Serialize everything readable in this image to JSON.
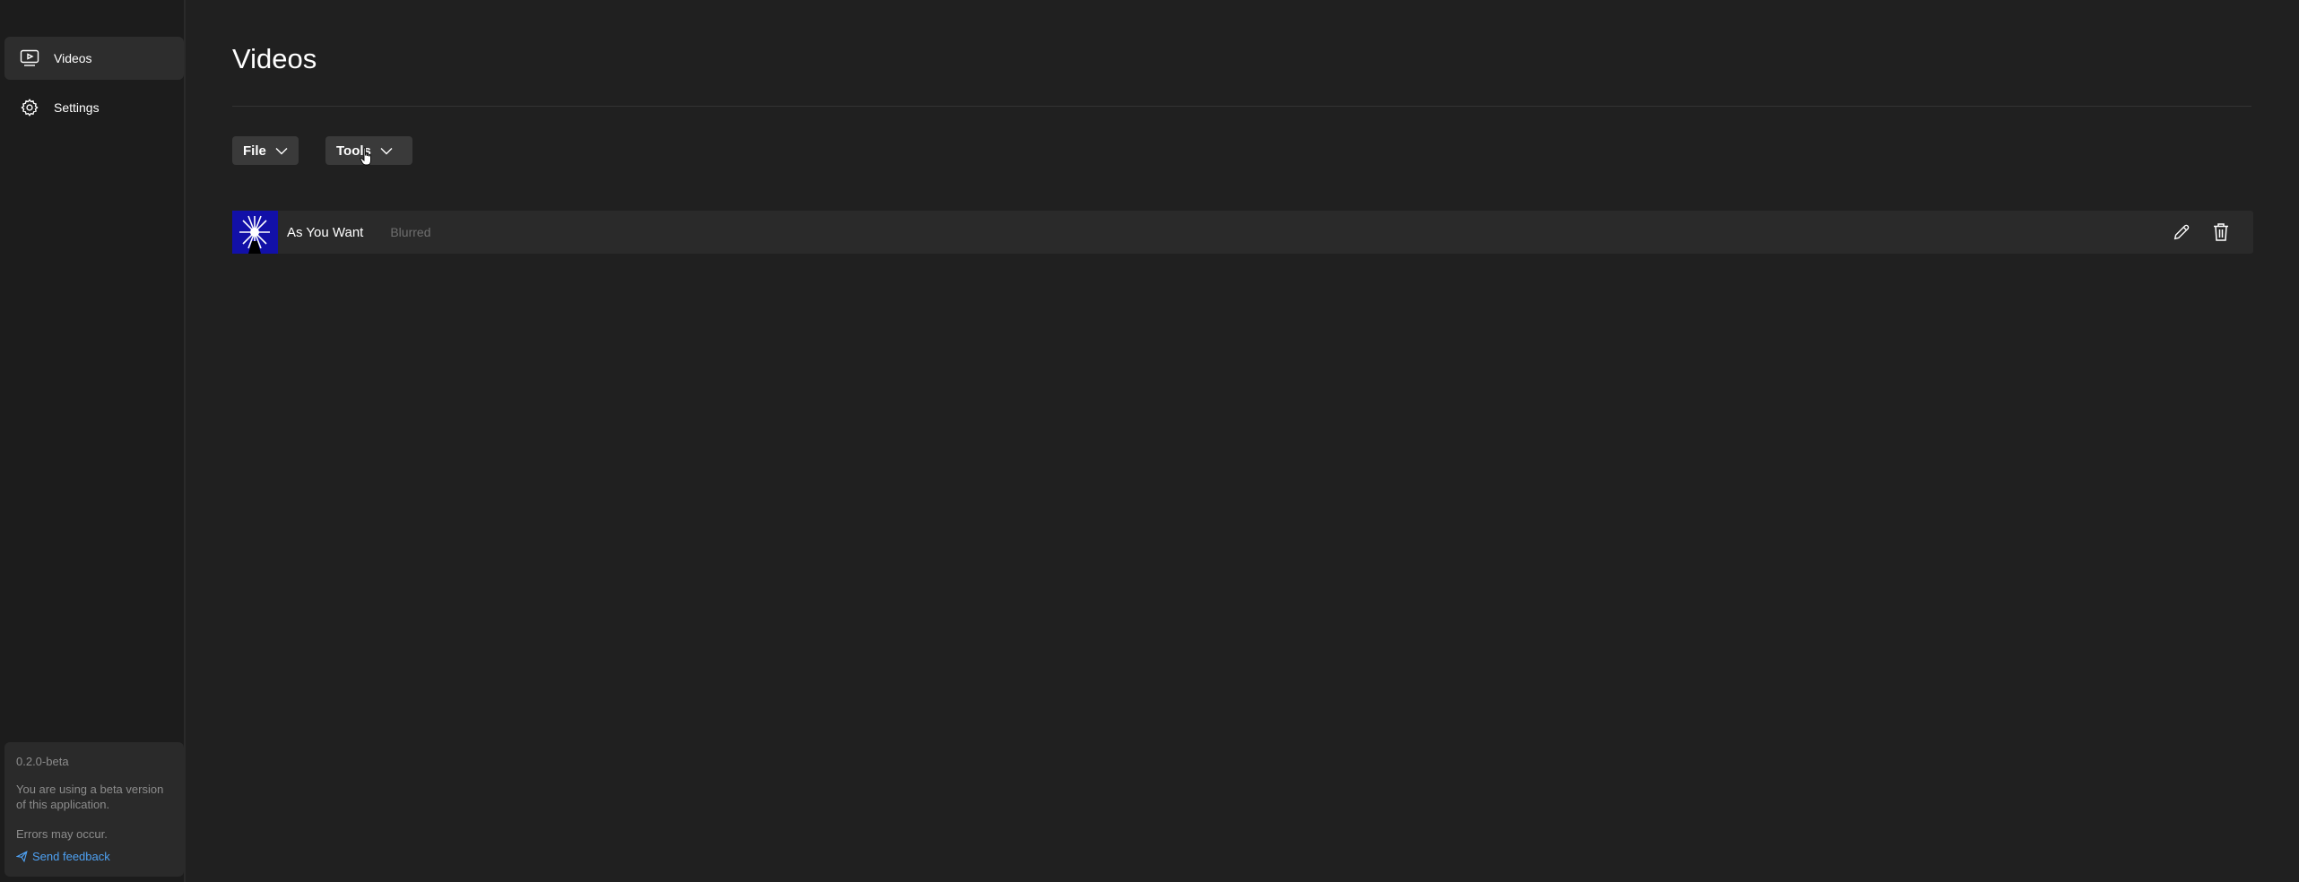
{
  "sidebar": {
    "items": [
      {
        "label": "Videos",
        "icon": "video-icon",
        "active": true
      },
      {
        "label": "Settings",
        "icon": "gear-icon",
        "active": false
      }
    ],
    "beta": {
      "version": "0.2.0-beta",
      "message": "You are using a beta version of this application.",
      "errors": "Errors may occur.",
      "feedback_label": "Send feedback"
    }
  },
  "main": {
    "title": "Videos",
    "toolbar": {
      "file_label": "File",
      "tools_label": "Tools"
    },
    "videos": [
      {
        "title": "As You Want",
        "status": "Blurred"
      }
    ]
  },
  "colors": {
    "background": "#202020",
    "sidebar": "#1c1c1c",
    "accent_link": "#4ea1f3",
    "row": "#2a2a2a",
    "button": "#3a3a3a"
  }
}
